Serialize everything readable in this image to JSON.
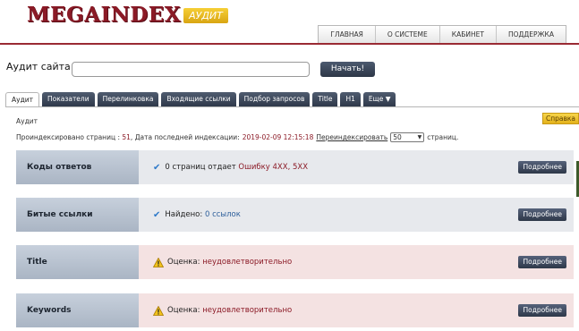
{
  "brand": {
    "name": "MEGAINDEX",
    "badge": "АУДИТ",
    "color": "#8b1a26",
    "badge_color": "#e6b520"
  },
  "topnav": [
    "ГЛАВНАЯ",
    "О СИСТЕМЕ",
    "КАБИНЕТ",
    "ПОДДЕРЖКА"
  ],
  "audit_form": {
    "label": "Аудит сайта:",
    "input_value": "",
    "start_label": "Начать!"
  },
  "tabs": [
    {
      "label": "Аудит",
      "active": true
    },
    {
      "label": "Показатели"
    },
    {
      "label": "Перелинковка"
    },
    {
      "label": "Входящие ссылки"
    },
    {
      "label": "Подбор запросов"
    },
    {
      "label": "Title"
    },
    {
      "label": "H1"
    },
    {
      "label": "Еще ▼"
    }
  ],
  "panel": {
    "title": "Аудит",
    "help_label": "Справка",
    "indexed_prefix": "Проиндексировано страниц :",
    "indexed_count": "51",
    "last_index_label": ", Дата последней индексации:",
    "last_index_date": "2019-02-09 12:15:18",
    "reindex_label": "Переиндексировать",
    "pages_value": "50",
    "pages_suffix": "страниц."
  },
  "rows": [
    {
      "label": "Коды ответов",
      "status": "ok",
      "icon": "check-icon",
      "text": "0 страниц отдает ",
      "highlight": "Ошибку 4XX, 5XX",
      "button": "Подробнее"
    },
    {
      "label": "Битые ссылки",
      "status": "ok",
      "icon": "check-icon",
      "text": "Найдено: ",
      "highlight": "0 ссылок",
      "button": "Подробнее"
    },
    {
      "label": "Title",
      "status": "bad",
      "icon": "warning-icon",
      "text": "Оценка: ",
      "highlight": "неудовлетворительно",
      "button": "Подробнее"
    },
    {
      "label": "Keywords",
      "status": "bad",
      "icon": "warning-icon",
      "text": "Оценка: ",
      "highlight": "неудовлетворительно",
      "button": "Подробнее"
    }
  ]
}
